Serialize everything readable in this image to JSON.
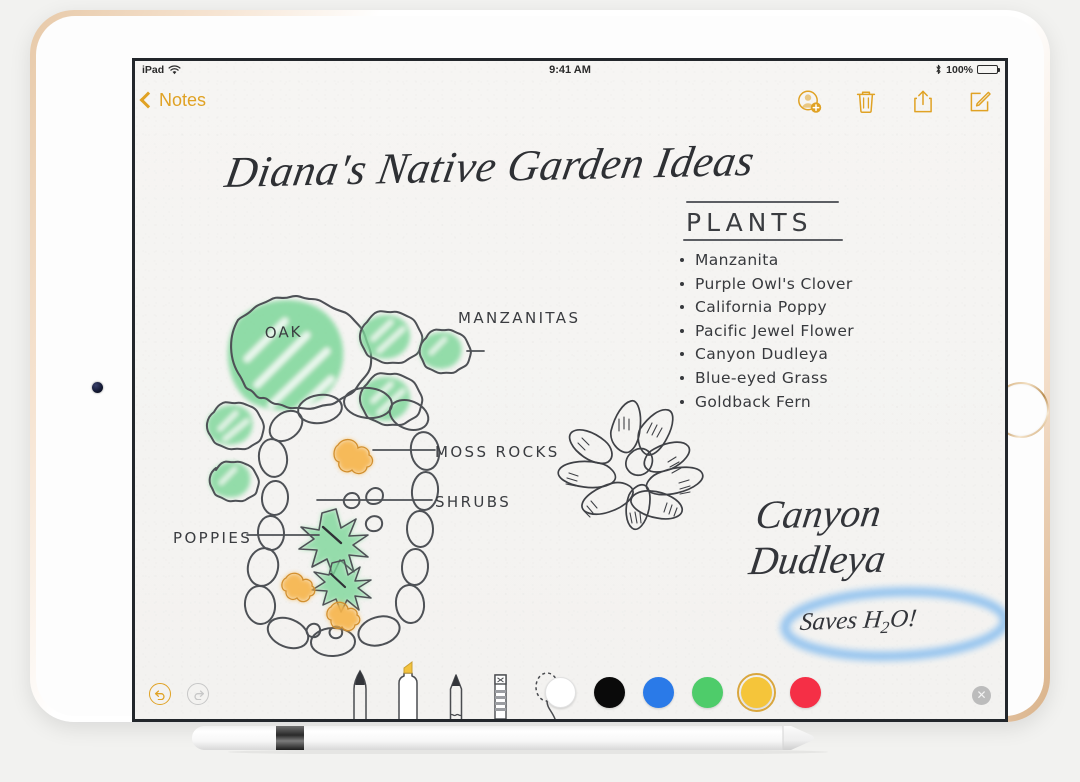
{
  "device": {
    "name": "iPad Pro",
    "finish_color": "#d9b289",
    "accessory": "apple-pencil"
  },
  "status_bar": {
    "carrier_label": "iPad",
    "wifi_icon": "wifi-icon",
    "time": "9:41 AM",
    "bluetooth_icon": "bluetooth-icon",
    "battery_percent": "100%",
    "battery_icon": "battery-full-icon"
  },
  "nav_bar": {
    "back_label": "Notes",
    "back_icon": "chevron-left-icon",
    "actions": [
      {
        "name": "add-collaborator-button",
        "icon": "person-add-icon"
      },
      {
        "name": "delete-note-button",
        "icon": "trash-icon"
      },
      {
        "name": "share-note-button",
        "icon": "share-icon"
      },
      {
        "name": "compose-note-button",
        "icon": "compose-icon"
      }
    ],
    "accent_color": "#e0a224"
  },
  "note": {
    "title": "Diana's Native Garden Ideas",
    "plants_heading": "PLANTS",
    "plants": [
      "Manzanita",
      "Purple Owl's Clover",
      "California Poppy",
      "Pacific Jewel Flower",
      "Canyon Dudleya",
      "Blue-eyed Grass",
      "Goldback Fern"
    ],
    "sketch_labels": {
      "oak": "OAK",
      "manzanitas": "MANZANITAS",
      "moss_rocks": "MOSS ROCKS",
      "shrubs": "SHRUBS",
      "poppies": "POPPIES"
    },
    "callout_name_line1": "Canyon",
    "callout_name_line2": "Dudleya",
    "highlighted_note": "Saves H2O!",
    "highlight_color": "#8ec1ef",
    "ink_color": "#33353a",
    "foliage_color": "#6ed48c",
    "poppy_color": "#f6b03a"
  },
  "tool_bar": {
    "undo": {
      "label": "undo-button",
      "icon": "undo-arrow-icon",
      "enabled": true
    },
    "redo": {
      "label": "redo-button",
      "icon": "redo-arrow-icon",
      "enabled": false
    },
    "tools": [
      {
        "name": "pen-tool",
        "label": "Pen",
        "selected": false
      },
      {
        "name": "highlighter-tool",
        "label": "Highlighter",
        "selected": true
      },
      {
        "name": "pencil-tool",
        "label": "Pencil",
        "selected": false
      },
      {
        "name": "eraser-tool",
        "label": "Eraser",
        "selected": false
      },
      {
        "name": "lasso-tool",
        "label": "Lasso",
        "selected": false
      }
    ],
    "colors": [
      {
        "name": "white",
        "hex": "#ffffff",
        "selected": false
      },
      {
        "name": "black",
        "hex": "#0a0a0a",
        "selected": false
      },
      {
        "name": "blue",
        "hex": "#2a7ae8",
        "selected": false
      },
      {
        "name": "green",
        "hex": "#4ecc6a",
        "selected": false
      },
      {
        "name": "yellow",
        "hex": "#f5c53a",
        "selected": true
      },
      {
        "name": "red",
        "hex": "#f52f46",
        "selected": false
      }
    ],
    "close_icon": "close-x-icon"
  }
}
